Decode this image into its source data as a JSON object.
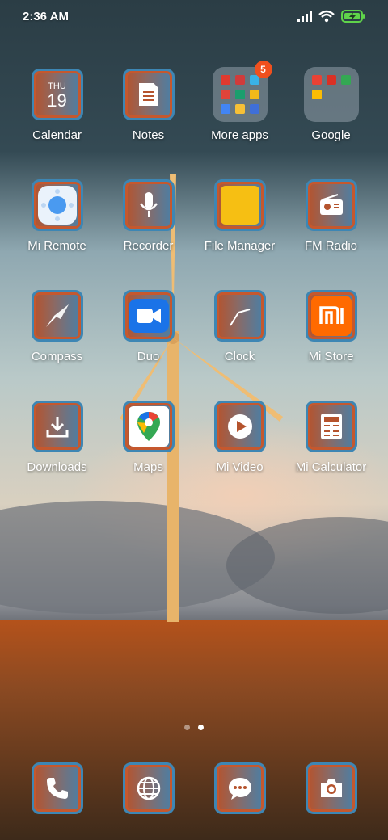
{
  "status_bar": {
    "time": "2:36 AM",
    "icons": [
      "signal-icon",
      "wifi-icon",
      "battery-charging-icon"
    ],
    "battery_color": "#5fd34a"
  },
  "calendar": {
    "day": "THU",
    "date": "19"
  },
  "folder_badge": "5",
  "apps": {
    "calendar": "Calendar",
    "notes": "Notes",
    "more_apps": "More apps",
    "google": "Google",
    "mi_remote": "Mi Remote",
    "recorder": "Recorder",
    "file_manager": "File Manager",
    "fm_radio": "FM Radio",
    "compass": "Compass",
    "duo": "Duo",
    "clock": "Clock",
    "mi_store": "Mi Store",
    "downloads": "Downloads",
    "maps": "Maps",
    "mi_video": "Mi Video",
    "mi_calculator": "Mi Calculator"
  },
  "dock": [
    "phone-icon",
    "browser-icon",
    "messages-icon",
    "camera-icon"
  ],
  "page_indicator": {
    "pages": 2,
    "current": 2
  },
  "colors": {
    "frame_outer": "#3d86b4",
    "frame_inner": "#c5582e",
    "badge": "#f0501e",
    "mi_store": "#ff6a00",
    "file_manager": "#f6bf13",
    "duo": "#1a73e8"
  }
}
